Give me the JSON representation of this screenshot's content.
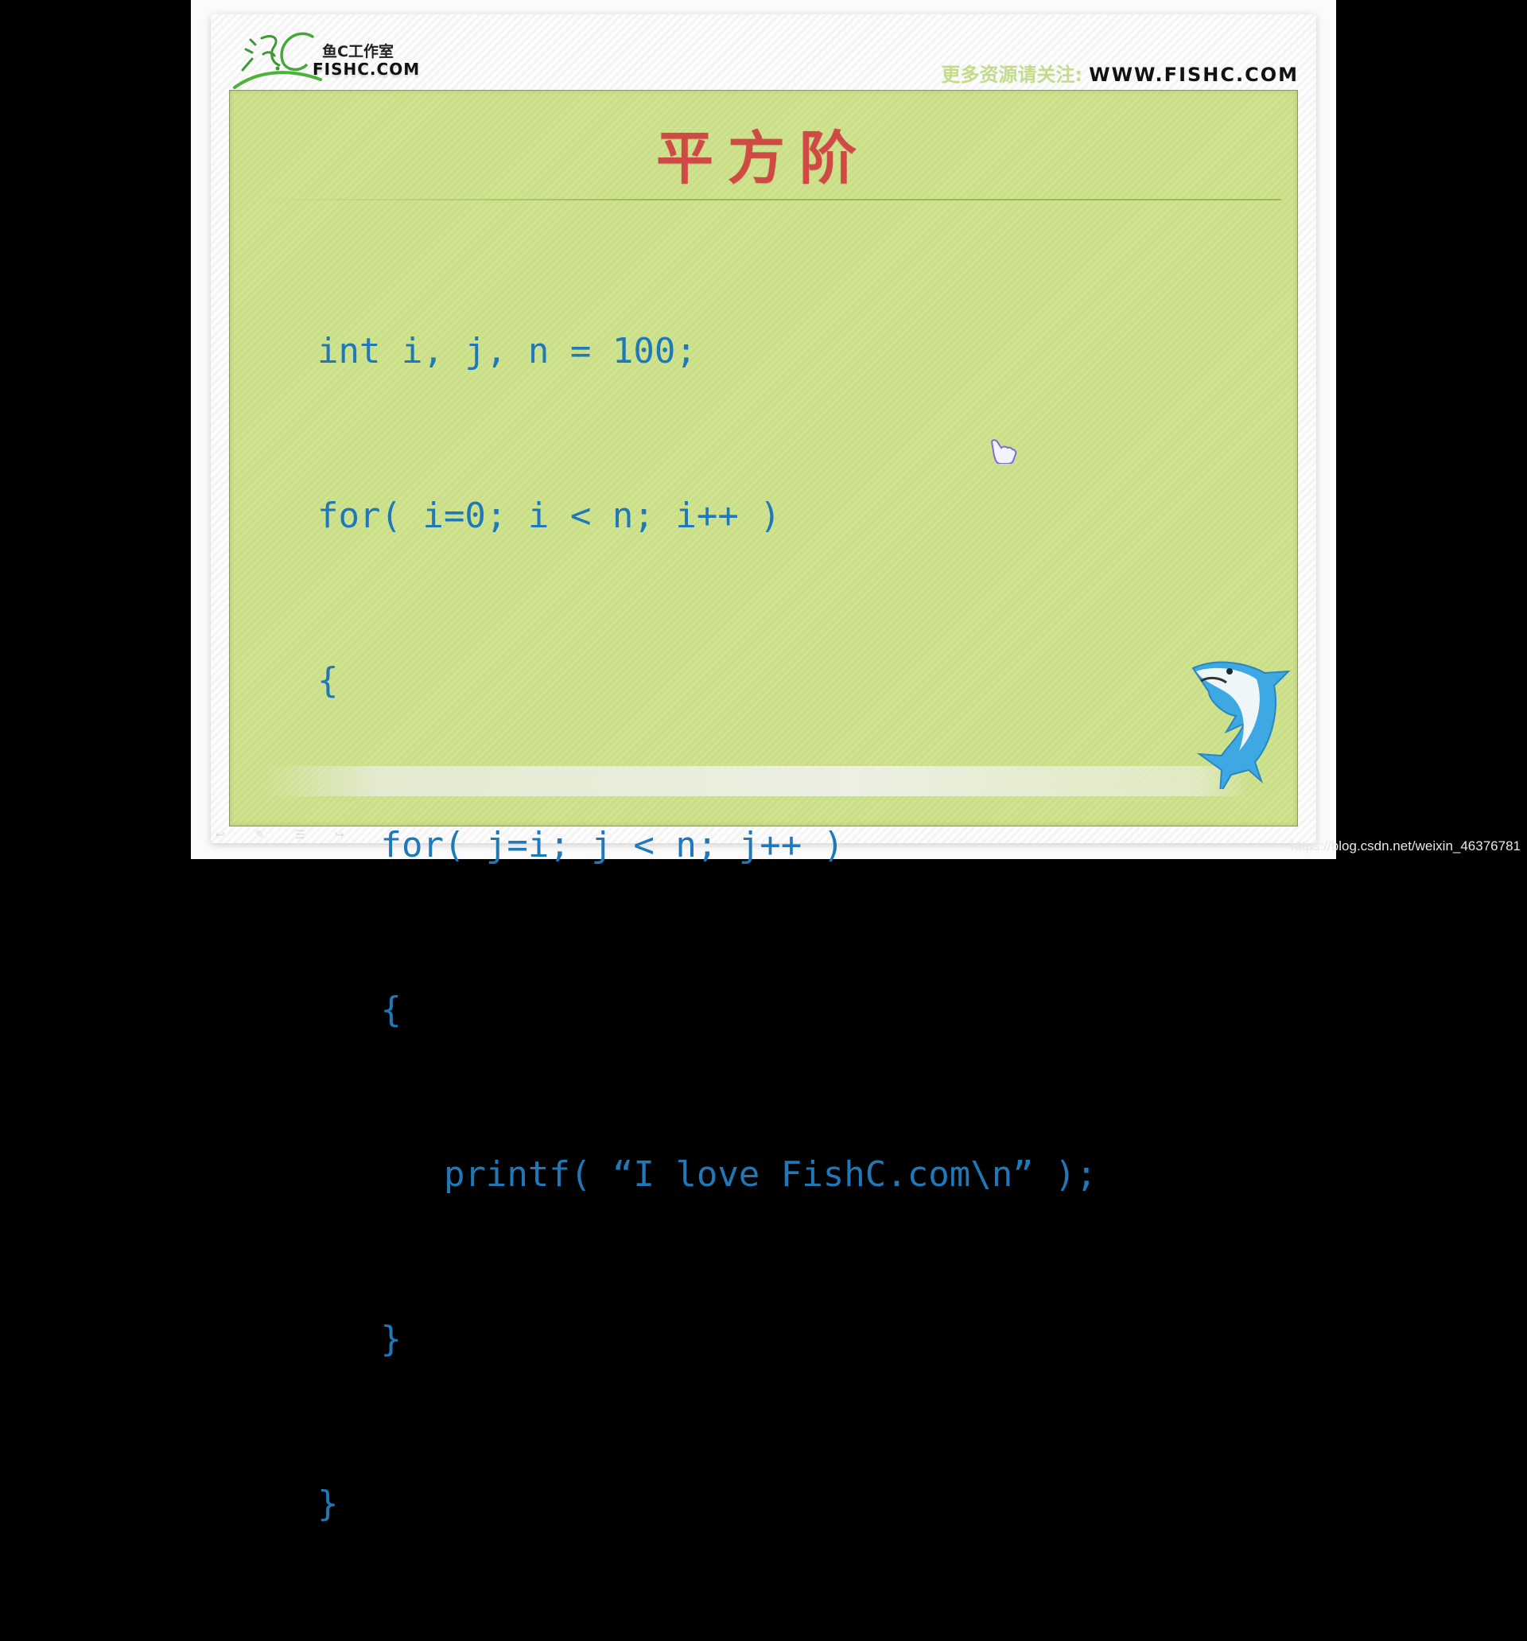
{
  "header": {
    "logo_script": "渔C",
    "logo_cn": "鱼C工作室",
    "logo_en": "FISHC.COM",
    "follow_label": "更多资源请关注:",
    "follow_url": "WWW.FISHC.COM"
  },
  "slide": {
    "title": "平方阶",
    "code_lines": [
      "int i, j, n = 100;",
      "for( i=0; i < n; i++ )",
      "{",
      "   for( j=i; j < n; j++ )",
      "   {",
      "      printf( “I love FishC.com\\n” );",
      "   }",
      "}"
    ],
    "mascot": "shark-icon"
  },
  "colors": {
    "panel_green": "#cde08c",
    "title_red": "#cf4a44",
    "code_blue": "#1f78b8",
    "follow_green": "#c3dc8c"
  },
  "watermark": "https://blog.csdn.net/weixin_46376781"
}
